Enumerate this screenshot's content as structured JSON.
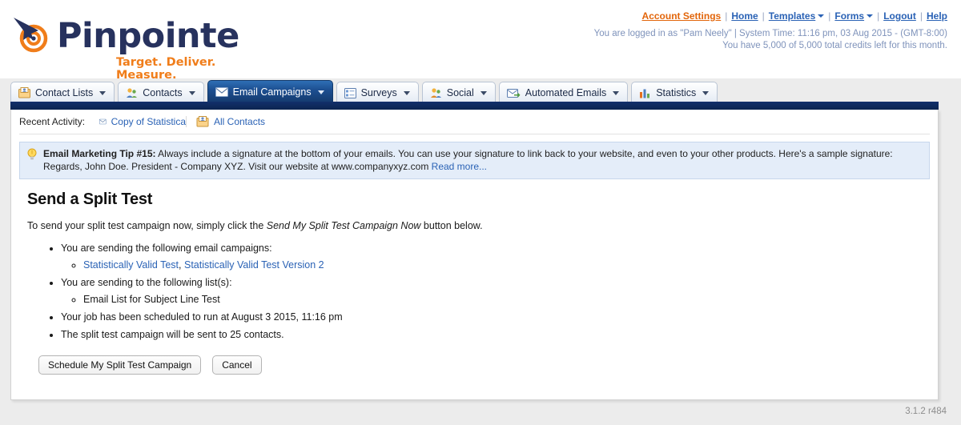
{
  "brand": {
    "name": "Pinpointe",
    "tagline": "Target. Deliver. Measure.",
    "logo_icon": "pinpointe-target-logo",
    "word_color": "#27325e",
    "accent_color": "#f07d1a"
  },
  "top_nav": {
    "links": [
      {
        "label": "Account Settings",
        "accent": true,
        "caret": false
      },
      {
        "label": "Home",
        "accent": false,
        "caret": false
      },
      {
        "label": "Templates",
        "accent": false,
        "caret": true
      },
      {
        "label": "Forms",
        "accent": false,
        "caret": true
      },
      {
        "label": "Logout",
        "accent": false,
        "caret": false
      },
      {
        "label": "Help",
        "accent": false,
        "caret": false
      }
    ],
    "separator": "|",
    "status_line_1": "You are logged in as \"Pam Neely\" | System Time: 11:16 pm, 03 Aug 2015 - (GMT-8:00)",
    "status_line_2": "You have 5,000 of 5,000 total credits left for this month."
  },
  "tabs": [
    {
      "label": "Contact Lists",
      "icon": "contact-lists-icon",
      "active": false
    },
    {
      "label": "Contacts",
      "icon": "contacts-icon",
      "active": false
    },
    {
      "label": "Email Campaigns",
      "icon": "envelope-icon",
      "active": true
    },
    {
      "label": "Surveys",
      "icon": "surveys-icon",
      "active": false
    },
    {
      "label": "Social",
      "icon": "social-icon",
      "active": false
    },
    {
      "label": "Automated Emails",
      "icon": "automated-emails-icon",
      "active": false
    },
    {
      "label": "Statistics",
      "icon": "statistics-bar-icon",
      "active": false
    }
  ],
  "recent_activity": {
    "label": "Recent Activity:",
    "items": [
      {
        "label": "Copy of Statistica",
        "icon": "envelope-icon",
        "clipped": true
      },
      {
        "label": "All Contacts",
        "icon": "contact-lists-icon",
        "clipped": false
      }
    ]
  },
  "tip": {
    "icon": "lightbulb-icon",
    "heading": "Email Marketing Tip #15:",
    "body": " Always include a signature at the bottom of your emails. You can use your signature to link back to your website, and even to your other products. Here's a sample signature: Regards, John Doe. President - Company XYZ. Visit our website at www.companyxyz.com ",
    "read_more": "Read more..."
  },
  "main": {
    "title": "Send a Split Test",
    "intro_before": "To send your split test campaign now, simply click the ",
    "intro_emphasis": "Send My Split Test Campaign Now",
    "intro_after": " button below.",
    "bullets": [
      {
        "text": "You are sending the following email campaigns:",
        "sub_links": [
          "Statistically Valid Test",
          "Statistically Valid Test Version 2"
        ],
        "sub_separator": ", "
      },
      {
        "text": "You are sending to the following list(s):",
        "sub_plain": [
          "Email List for Subject Line Test"
        ]
      },
      {
        "text": "Your job has been scheduled to run at August 3 2015, 11:16 pm"
      },
      {
        "text": "The split test campaign will be sent to 25 contacts."
      }
    ],
    "buttons": {
      "primary_label": "Schedule My Split Test Campaign",
      "cancel_label": "Cancel"
    }
  },
  "footer": {
    "version": "3.1.2 r484"
  },
  "colors": {
    "active_tab": "#14396c",
    "blue_bar": "#12306b",
    "link": "#2a62b5",
    "tip_bg": "#e4edf9",
    "page_bg": "#ececec"
  }
}
